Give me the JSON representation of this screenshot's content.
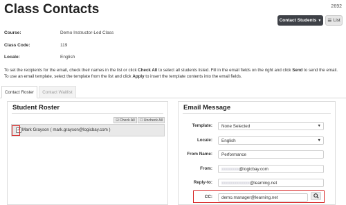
{
  "header": {
    "title": "Class Contacts",
    "page_number": "2692",
    "contact_button": "Contact Students",
    "list_button": "List"
  },
  "info": {
    "course_label": "Course:",
    "course_value": "Demo Instructor-Led Class",
    "class_code_label": "Class Code:",
    "class_code_value": "119",
    "locale_label": "Locale:",
    "locale_value": "English"
  },
  "instructions": {
    "line1_a": "To set the recipients for the email, check their names in the list or click ",
    "line1_b": "Check All",
    "line1_c": " to select all students listed. Fill in the email fields on the right and click ",
    "line1_d": "Send",
    "line1_e": " to send the email.",
    "line2_a": "To use an email template, select the template from the list and click ",
    "line2_b": "Apply",
    "line2_c": " to insert the template contents into the email fields."
  },
  "tabs": [
    {
      "label": "Contact Roster",
      "active": true
    },
    {
      "label": "Contact Waitlist",
      "active": false
    }
  ],
  "roster": {
    "title": "Student Roster",
    "check_all": "Check All",
    "uncheck_all": "Uncheck All",
    "student": "Mark Grayson ( mark.grayson@logicbay.com )",
    "student_checked": true
  },
  "email": {
    "title": "Email Message",
    "template_label": "Template:",
    "template_value": "None Selected",
    "locale_label": "Locale:",
    "locale_value": "English",
    "from_name_label": "From Name:",
    "from_name_value": "Performance",
    "from_label": "From:",
    "from_value": "@logicbay.com",
    "reply_to_label": "Reply-to:",
    "reply_to_value": "@learning.net",
    "cc_label": "CC:",
    "cc_value": "demo.manager@learning.net"
  },
  "icons": {
    "dropdown_caret": "caret-down-icon",
    "list": "list-icon",
    "check_all": "check-icon",
    "uncheck_all": "uncheck-icon",
    "search": "search-icon"
  },
  "colors": {
    "primary_button": "#3e4147",
    "highlight": "#d62020"
  }
}
